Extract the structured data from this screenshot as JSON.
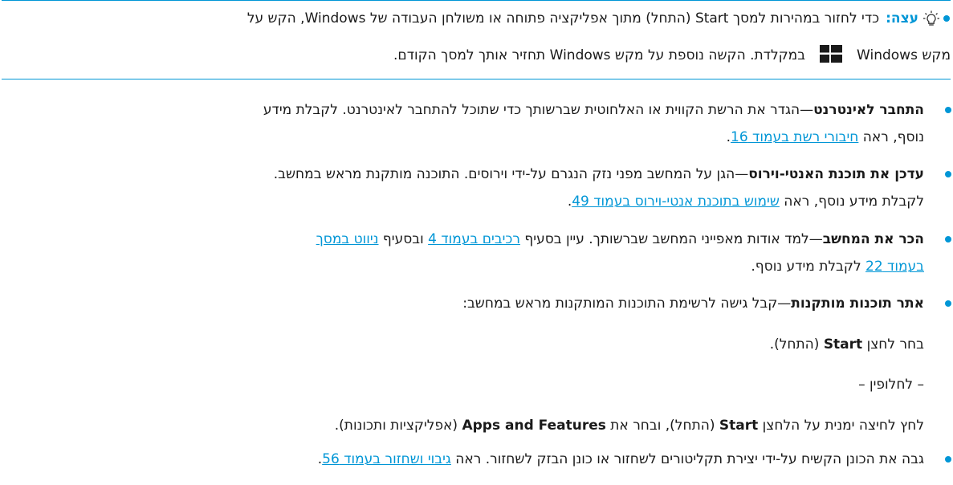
{
  "tip": {
    "label": "עצה:",
    "line1": "כדי לחזור במהירות למסך Start (התחל) מתוך אפליקציה פתוחה או משולחן העבודה של Windows, הקש על",
    "line2_before": "מקש Windows",
    "line2_after": "במקלדת. הקשה נוספת על מקש Windows תחזיר אותך למסך הקודם.",
    "icon": "lightbulb-icon",
    "logo": "windows-logo-icon"
  },
  "items": {
    "internet": {
      "title": "התחבר לאינטרנט",
      "text1": "—הגדר את הרשת הקווית או האלחוטית שברשותך כדי שתוכל להתחבר לאינטרנט. לקבלת מידע",
      "text2_before": "נוסף, ראה ",
      "link": "חיבורי רשת בעמוד 16",
      "text2_after": "."
    },
    "antivirus": {
      "title": "עדכן את תוכנת האנטי-וירוס",
      "text1": "—הגן על המחשב מפני נזק הנגרם על-ידי וירוסים. התוכנה מותקנת מראש במחשב.",
      "text2_before": "לקבלת מידע נוסף, ראה ",
      "link": "שימוש בתוכנת אנטי-וירוס בעמוד 49",
      "text2_after": "."
    },
    "know": {
      "title": "הכר את המחשב",
      "text1": "—למד אודות מאפייני המחשב שברשותך. עיין בסעיף ",
      "link1": "רכיבים בעמוד 4",
      "text_mid": " ובסעיף ",
      "link2a": "ניווט במסך",
      "link2b": "בעמוד 22",
      "text2_after": " לקבלת מידע נוסף."
    },
    "apps": {
      "title": "אתר תוכנות מותקנות",
      "text1": "—קבל גישה לרשימת התוכנות המותקנות מראש במחשב:",
      "step1_before": "בחר לחצן ",
      "step1_bold": "Start",
      "step1_after": " (התחל).",
      "or": "– לחלופין –",
      "step2_a": "לחץ לחיצה ימנית על הלחצן ",
      "step2_bold1": "Start",
      "step2_b": " (התחל), ובחר את ",
      "step2_bold2": "Apps and Features",
      "step2_c": " (אפליקציות ותכונות)."
    },
    "backup": {
      "text_before": "גבה את הכונן הקשיח על-ידי יצירת תקליטורים לשחזור או כונן הבזק לשחזור. ראה ",
      "link": "גיבוי ושחזור בעמוד 56",
      "text_after": "."
    }
  },
  "colors": {
    "accent": "#0096d6"
  }
}
